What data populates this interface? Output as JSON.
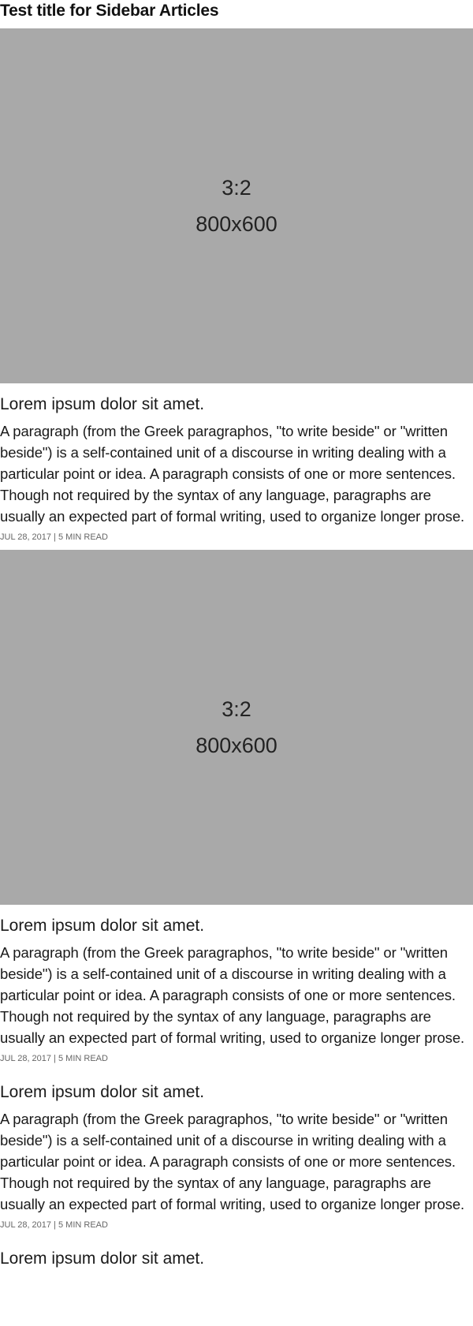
{
  "sidebar": {
    "title": "Test title for Sidebar Articles",
    "articles": [
      {
        "image": {
          "ratio": "3:2",
          "size": "800x600"
        },
        "title": "Lorem ipsum dolor sit amet.",
        "body": "A paragraph (from the Greek paragraphos, \"to write beside\" or \"written beside\") is a self-contained unit of a discourse in writing dealing with a particular point or idea. A paragraph consists of one or more sentences. Though not required by the syntax of any language, paragraphs are usually an expected part of formal writing, used to organize longer prose.",
        "meta": "JUL 28, 2017 | 5 MIN READ"
      },
      {
        "image": {
          "ratio": "3:2",
          "size": "800x600"
        },
        "title": "Lorem ipsum dolor sit amet.",
        "body": "A paragraph (from the Greek paragraphos, \"to write beside\" or \"written beside\") is a self-contained unit of a discourse in writing dealing with a particular point or idea. A paragraph consists of one or more sentences. Though not required by the syntax of any language, paragraphs are usually an expected part of formal writing, used to organize longer prose.",
        "meta": "JUL 28, 2017 | 5 MIN READ"
      },
      {
        "title": "Lorem ipsum dolor sit amet.",
        "body": "A paragraph (from the Greek paragraphos, \"to write beside\" or \"written beside\") is a self-contained unit of a discourse in writing dealing with a particular point or idea. A paragraph consists of one or more sentences. Though not required by the syntax of any language, paragraphs are usually an expected part of formal writing, used to organize longer prose.",
        "meta": "JUL 28, 2017 | 5 MIN READ"
      },
      {
        "title": "Lorem ipsum dolor sit amet."
      }
    ]
  }
}
